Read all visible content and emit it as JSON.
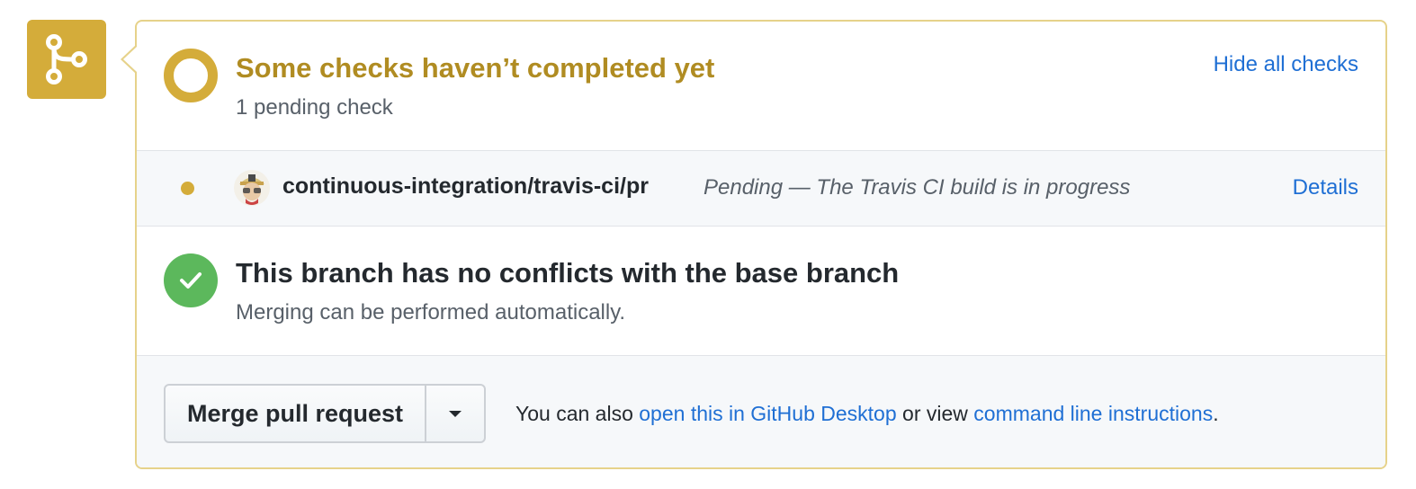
{
  "checks_status": {
    "title": "Some checks haven’t completed yet",
    "subtitle": "1 pending check",
    "hide_link": "Hide all checks"
  },
  "check": {
    "name": "continuous-integration/travis-ci/pr",
    "description": "Pending — The Travis CI build is in progress",
    "details_link": "Details",
    "status_color": "#d4ac3a"
  },
  "conflicts": {
    "title": "This branch has no conflicts with the base branch",
    "subtitle": "Merging can be performed automatically."
  },
  "merge": {
    "button_label": "Merge pull request",
    "text_prefix": "You can also ",
    "desktop_link": "open this in GitHub Desktop",
    "text_middle": " or view ",
    "cli_link": "command line instructions",
    "text_suffix": "."
  },
  "colors": {
    "pending": "#d4ac3a",
    "pending_text": "#b08c22",
    "success": "#5cb85c",
    "link": "#1f6fd4"
  },
  "icons": {
    "merge_status": "git-merge-icon",
    "pending": "pending-ring-icon",
    "check_status": "dot-icon",
    "avatar": "travis-ci-avatar",
    "success": "check-icon",
    "dropdown": "caret-down-icon"
  }
}
